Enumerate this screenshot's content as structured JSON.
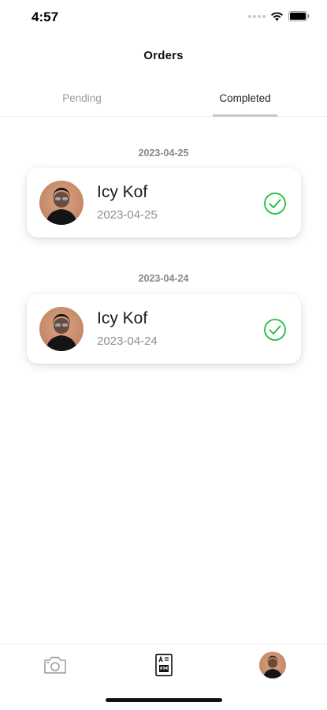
{
  "status_bar": {
    "time": "4:57"
  },
  "header": {
    "title": "Orders"
  },
  "tabs": [
    {
      "label": "Pending",
      "active": false
    },
    {
      "label": "Completed",
      "active": true
    }
  ],
  "groups": [
    {
      "date": "2023-04-25",
      "orders": [
        {
          "name": "Icy Kof",
          "date": "2023-04-25",
          "status": "completed"
        }
      ]
    },
    {
      "date": "2023-04-24",
      "orders": [
        {
          "name": "Icy Kof",
          "date": "2023-04-24",
          "status": "completed"
        }
      ]
    }
  ],
  "bottom_nav": [
    {
      "icon": "camera-icon"
    },
    {
      "icon": "orders-document-icon"
    },
    {
      "icon": "profile-avatar"
    }
  ],
  "colors": {
    "accent_check": "#1fbf3a",
    "tab_indicator": "#c7c7c7",
    "muted_text": "#8e8e8e"
  }
}
